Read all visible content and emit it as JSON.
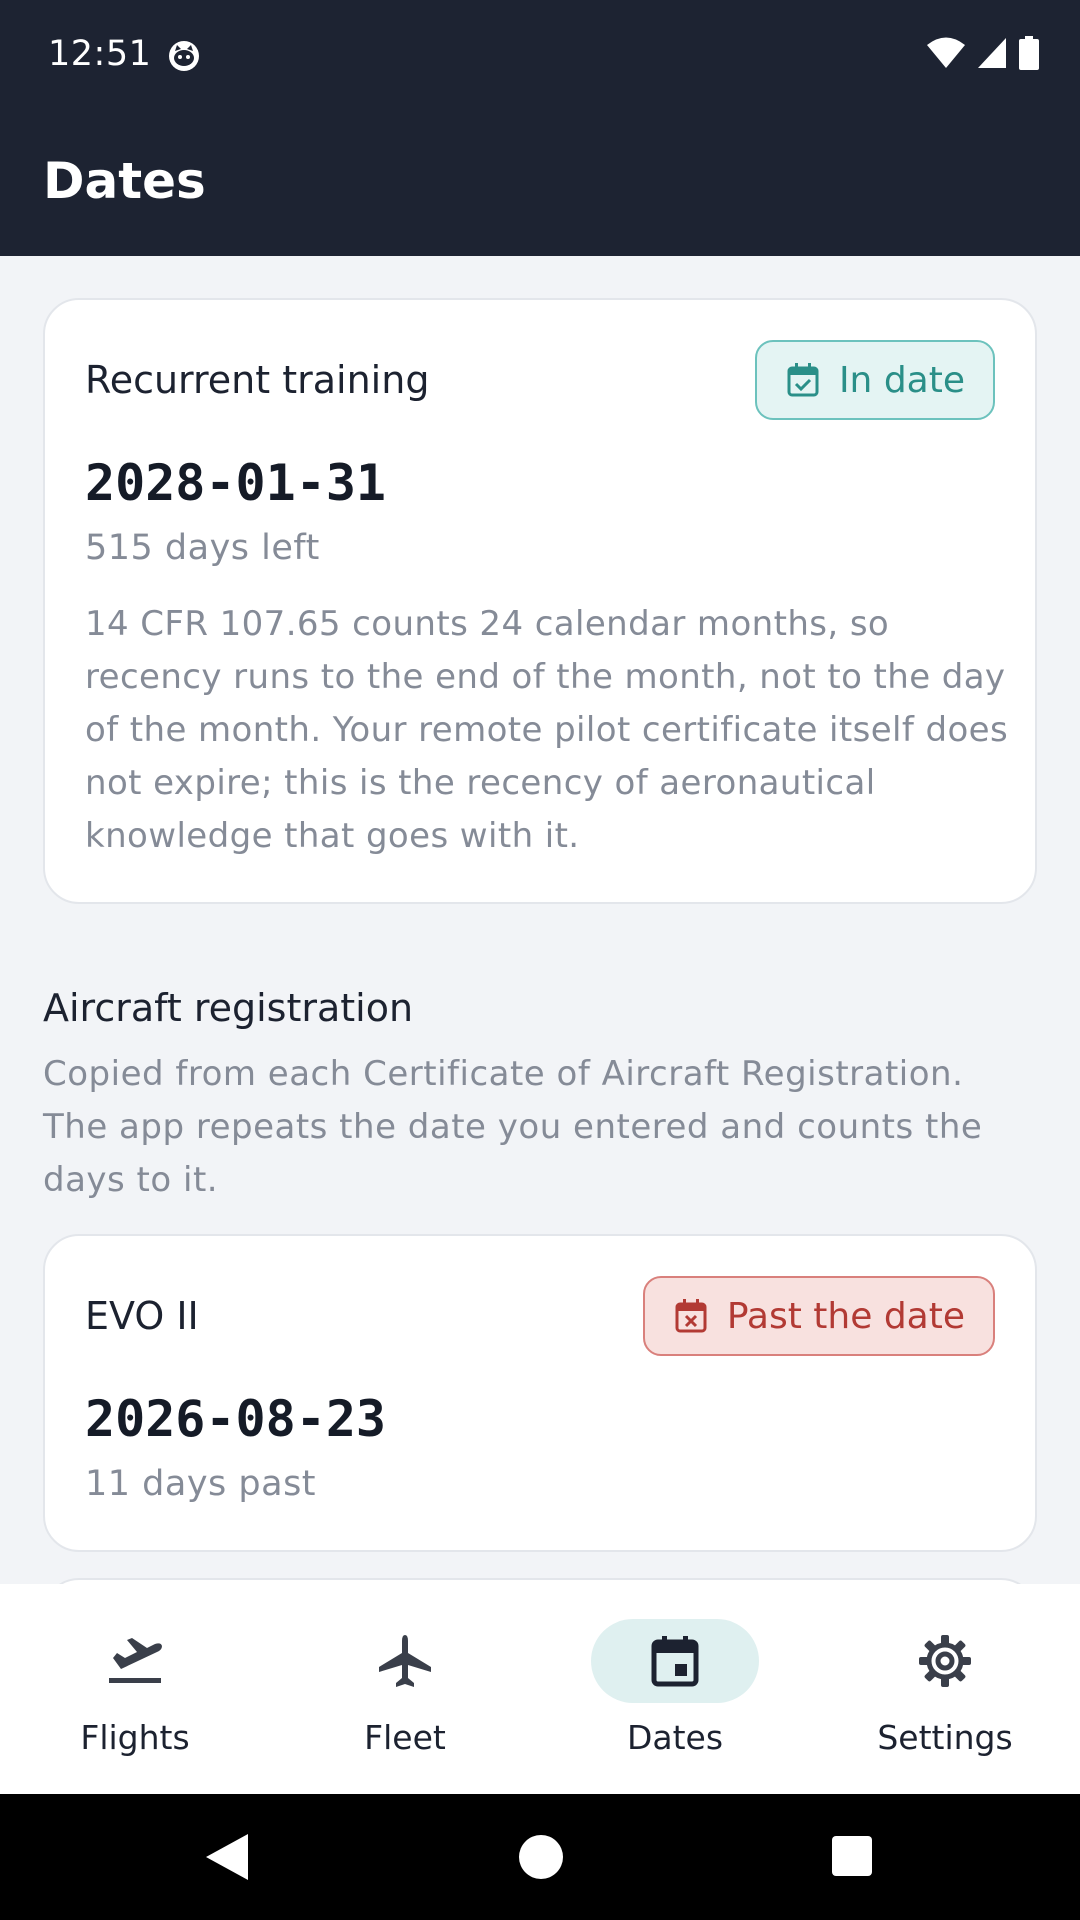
{
  "status_bar": {
    "time": "12:51",
    "icons": [
      "cat-notification-icon",
      "wifi-icon",
      "cellular-signal-icon",
      "battery-icon"
    ]
  },
  "app_bar": {
    "title": "Dates"
  },
  "recurrent_training": {
    "title": "Recurrent training",
    "badge": "In date",
    "badge_icon": "calendar-check-icon",
    "date": "2028-01-31",
    "days_text": "515 days left",
    "note": "14 CFR 107.65 counts 24 calendar months, so recency runs to the end of the month, not to the day of the month. Your remote pilot certificate itself does not expire; this is the recency of aeronautical knowledge that goes with it."
  },
  "aircraft_registration": {
    "title": "Aircraft registration",
    "description": "Copied from each Certificate of Aircraft Registration. The app repeats the date you entered and counts the days to it.",
    "items": [
      {
        "name": "EVO II",
        "badge": "Past the date",
        "badge_icon": "calendar-x-icon",
        "date": "2026-08-23",
        "days_text": "11 days past"
      }
    ]
  },
  "bottom_nav": {
    "items": [
      {
        "label": "Flights",
        "icon": "flight-takeoff-icon",
        "active": false
      },
      {
        "label": "Fleet",
        "icon": "airplane-icon",
        "active": false
      },
      {
        "label": "Dates",
        "icon": "calendar-icon",
        "active": true
      },
      {
        "label": "Settings",
        "icon": "gear-icon",
        "active": false
      }
    ]
  },
  "colors": {
    "header_bg": "#1d2332",
    "in_date_accent": "#2a8f88",
    "past_date_accent": "#b23a34",
    "active_nav_pill": "#dff0f0"
  }
}
